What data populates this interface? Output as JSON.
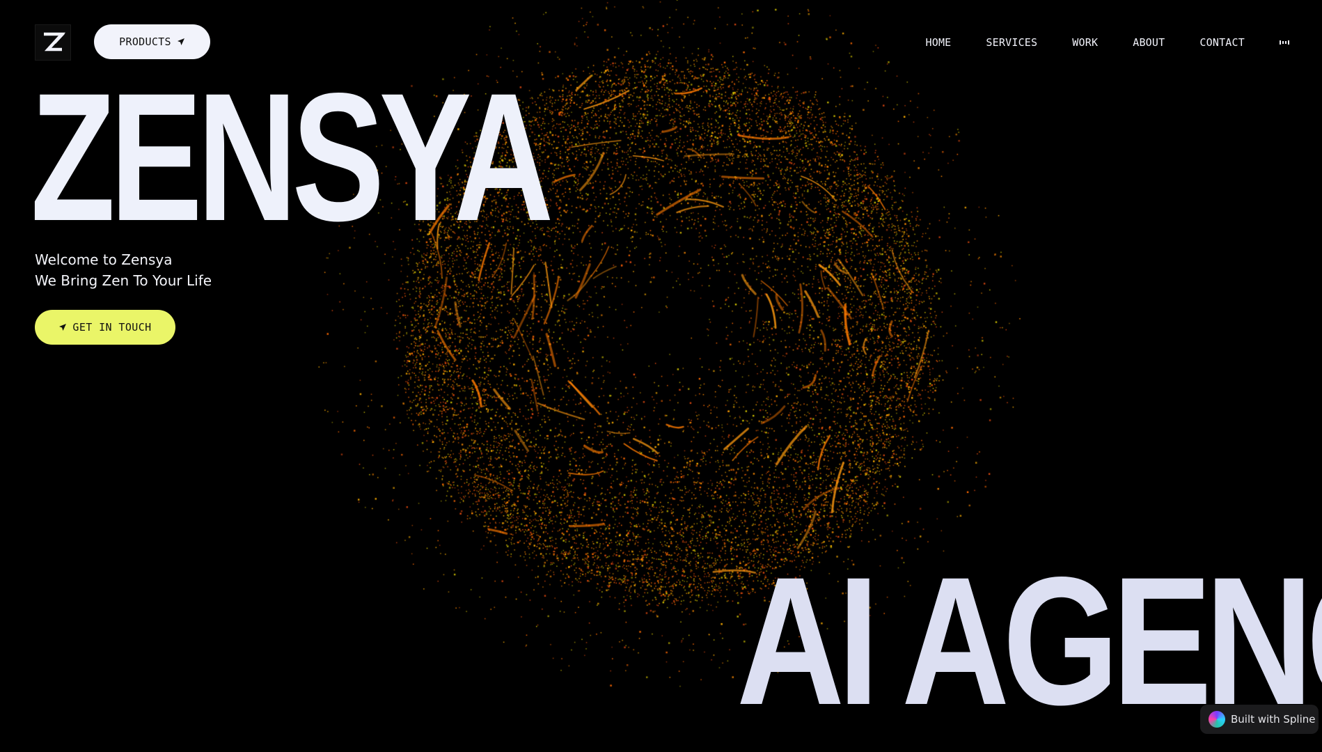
{
  "header": {
    "logo_alt": "Zensya logo",
    "products_label": "PRODUCTS",
    "nav": [
      "HOME",
      "SERVICES",
      "WORK",
      "ABOUT",
      "CONTACT"
    ]
  },
  "hero": {
    "title": "ZENSYA",
    "tagline_line1": "Welcome to Zensya",
    "tagline_line2": "We Bring Zen To Your Life",
    "cta_label": "GET IN TOUCH",
    "subtitle_big": "AI AGENCY"
  },
  "badge": {
    "label": "Built with Spline"
  },
  "icons": {
    "products": "send-arrow-icon",
    "cta": "send-arrow-icon",
    "menu": "menu-icon",
    "badge": "spline-logo-icon"
  },
  "colors": {
    "background": "#000000",
    "text": "#eef1fb",
    "cta_bg": "#eaf568",
    "products_bg": "#f2f3fb",
    "particles": [
      "#ff6a00",
      "#ff8c00",
      "#ffb000",
      "#e24a10",
      "#cfc000"
    ]
  }
}
